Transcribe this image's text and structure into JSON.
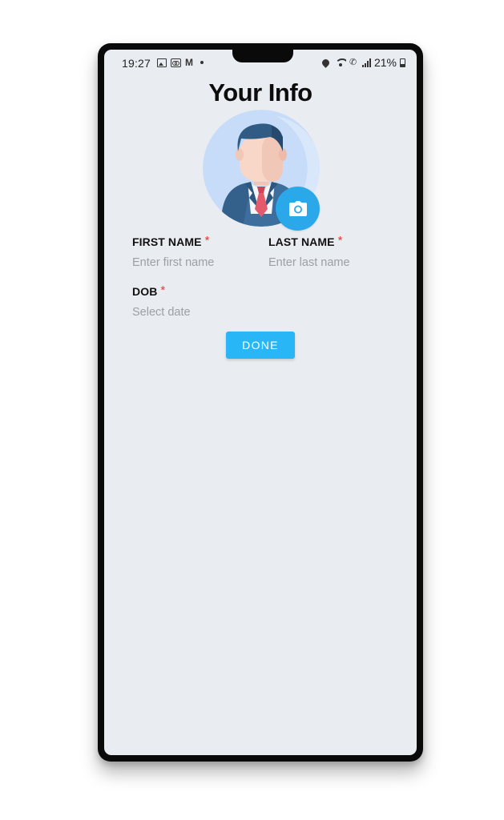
{
  "status_bar": {
    "time": "19:27",
    "battery": "21%"
  },
  "page": {
    "title": "Your Info"
  },
  "avatar": {
    "icon": "person-avatar-icon",
    "camera_icon": "camera-icon"
  },
  "form": {
    "first_name": {
      "label": "FIRST NAME",
      "required": "*",
      "value": "",
      "placeholder": "Enter first name"
    },
    "last_name": {
      "label": "LAST NAME",
      "required": "*",
      "value": "",
      "placeholder": "Enter last name"
    },
    "dob": {
      "label": "DOB",
      "required": "*",
      "value": "",
      "placeholder": "Select date"
    }
  },
  "actions": {
    "done_label": "DONE"
  },
  "colors": {
    "accent": "#29b6f6",
    "camera_button": "#2aa8ea",
    "required": "#e53935",
    "screen_bg": "#e9ecf0"
  }
}
